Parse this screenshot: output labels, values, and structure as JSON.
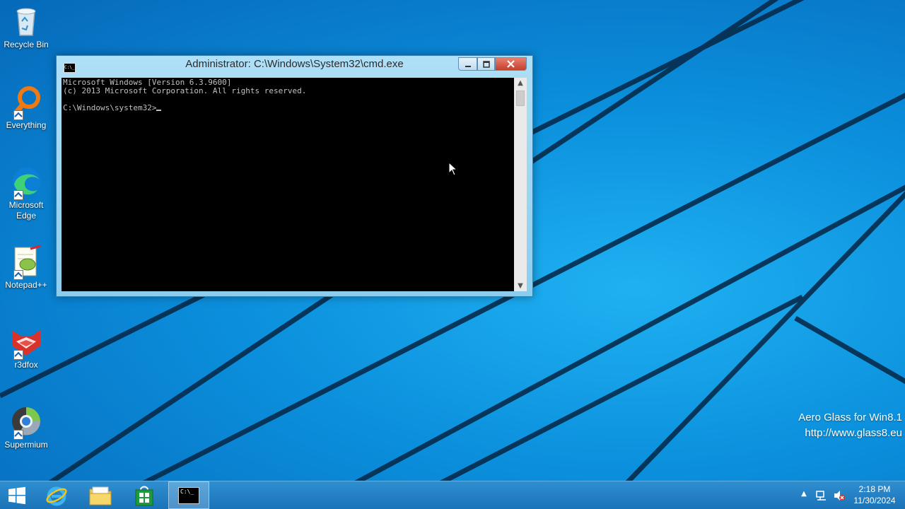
{
  "desktop": {
    "icons": [
      {
        "label": "Recycle Bin"
      },
      {
        "label": "Everything"
      },
      {
        "label": "Microsoft Edge"
      },
      {
        "label": "Notepad++"
      },
      {
        "label": "r3dfox"
      },
      {
        "label": "Supermium"
      }
    ],
    "watermark": {
      "line1": "Aero Glass for Win8.1",
      "line2": "http://www.glass8.eu"
    }
  },
  "cmd_window": {
    "title": "Administrator: C:\\Windows\\System32\\cmd.exe",
    "icon_text": "C:\\_",
    "lines": [
      "Microsoft Windows [Version 6.3.9600]",
      "(c) 2013 Microsoft Corporation. All rights reserved.",
      "",
      "C:\\Windows\\system32>"
    ]
  },
  "taskbar": {
    "cmd_icon_text": "C:\\_",
    "clock": {
      "time": "2:18 PM",
      "date": "11/30/2024"
    }
  },
  "colors": {
    "wallpaper": "#0b8fdc",
    "taskbar": "#1b73b8",
    "console_bg": "#000000",
    "console_text": "#c0c0c0",
    "close_button": "#c4402b"
  }
}
